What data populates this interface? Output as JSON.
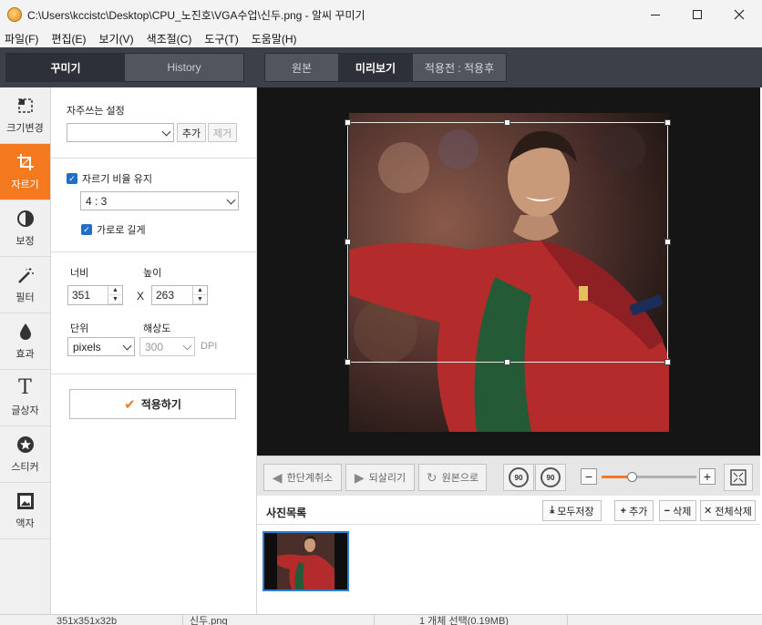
{
  "window": {
    "title": "C:\\Users\\kccistc\\Desktop\\CPU_노진호\\VGA수업\\신두.png - 알씨 꾸미기"
  },
  "menu": [
    "파일(F)",
    "편집(E)",
    "보기(V)",
    "색조절(C)",
    "도구(T)",
    "도움말(H)"
  ],
  "left_tabs": {
    "decorate": "꾸미기",
    "history": "History",
    "active": "꾸미기"
  },
  "view_tabs": {
    "original": "원본",
    "preview": "미리보기",
    "compare": "적용전 : 적용후",
    "active": "미리보기"
  },
  "tools": [
    {
      "label": "크기변경",
      "icon": "resize-icon"
    },
    {
      "label": "자르기",
      "icon": "crop-icon",
      "active": true
    },
    {
      "label": "보정",
      "icon": "contrast-icon"
    },
    {
      "label": "필터",
      "icon": "magic-wand-icon"
    },
    {
      "label": "효과",
      "icon": "drop-icon"
    },
    {
      "label": "글상자",
      "icon": "text-icon"
    },
    {
      "label": "스티커",
      "icon": "star-icon"
    },
    {
      "label": "액자",
      "icon": "frame-icon"
    }
  ],
  "crop_panel": {
    "favorites_label": "자주쓰는 설정",
    "favorites_value": "",
    "add_label": "추가",
    "remove_label": "제거",
    "keep_ratio_label": "자르기 비율 유지",
    "keep_ratio_checked": true,
    "ratio_value": "4 : 3",
    "landscape_label": "가로로 길게",
    "landscape_checked": true,
    "width_label": "너비",
    "height_label": "높이",
    "width_value": "351",
    "height_value": "263",
    "x_sep": "X",
    "unit_label": "단위",
    "unit_value": "pixels",
    "resolution_label": "해상도",
    "resolution_value": "300",
    "dpi_label": "DPI",
    "apply_label": "적용하기"
  },
  "toolbar": {
    "undo_label": "한단계취소",
    "redo_label": "되살리기",
    "restore_label": "원본으로",
    "rotate_left_label": "90",
    "rotate_right_label": "90",
    "zoom_level": 0.32
  },
  "photo_list": {
    "title": "사진목록",
    "save_all_label": "모두저장",
    "add_label": "추가",
    "delete_label": "삭제",
    "delete_all_label": "전체삭제"
  },
  "status": {
    "dimensions": "351x351x32b",
    "filename": "신두.png",
    "selection": "1 개체 선택(0.19MB)"
  },
  "colors": {
    "accent": "#f4791f",
    "dark_band": "#3c4049",
    "selection_blue": "#2a7fd4"
  }
}
